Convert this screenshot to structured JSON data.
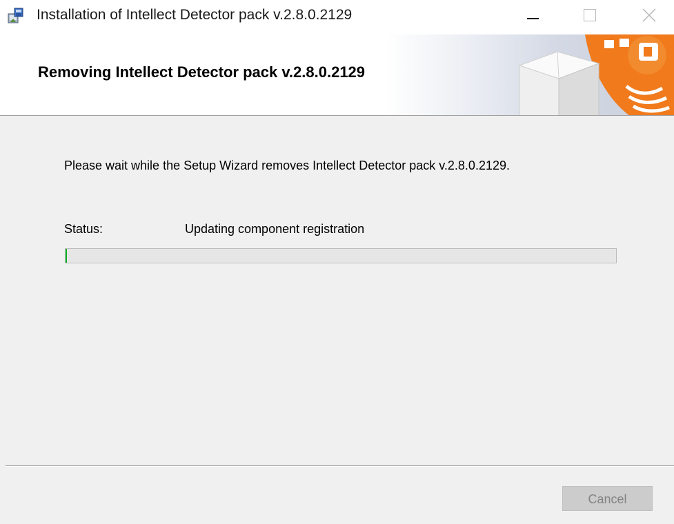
{
  "window": {
    "title": "Installation of Intellect Detector pack v.2.8.0.2129"
  },
  "banner": {
    "title": "Removing Intellect Detector pack v.2.8.0.2129"
  },
  "main": {
    "wait_message": "Please wait while the Setup Wizard removes Intellect Detector pack v.2.8.0.2129.",
    "status_label": "Status:",
    "status_value": "Updating component registration",
    "progress_fraction": 0.003
  },
  "footer": {
    "cancel_label": "Cancel",
    "cancel_enabled": false
  },
  "icons": {
    "app": "installer-icon",
    "minimize": "minimize-icon",
    "maximize": "maximize-icon",
    "close": "close-icon",
    "banner": "package-box-icon"
  },
  "colors": {
    "accent_orange": "#f07a1c",
    "progress_green": "#06b025"
  }
}
